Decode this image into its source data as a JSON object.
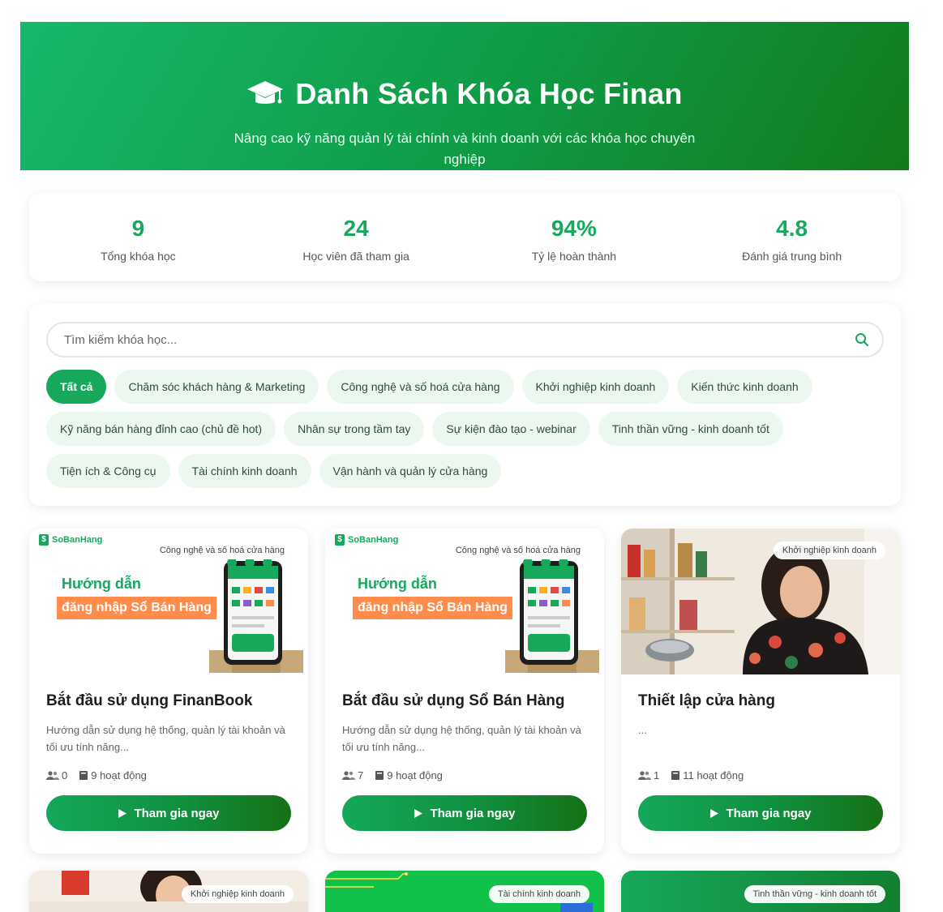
{
  "header": {
    "icon": "graduation-cap-icon",
    "title": "Danh Sách Khóa Học Finan",
    "subtitle": "Nâng cao kỹ năng quản lý tài chính và kinh doanh với các khóa học chuyên nghiệp"
  },
  "stats": [
    {
      "value": "9",
      "label": "Tổng khóa học"
    },
    {
      "value": "24",
      "label": "Học viên đã tham gia"
    },
    {
      "value": "94%",
      "label": "Tỷ lệ hoàn thành"
    },
    {
      "value": "4.8",
      "label": "Đánh giá trung bình"
    }
  ],
  "search": {
    "placeholder": "Tìm kiếm khóa học..."
  },
  "filters": {
    "active": "Tất cả",
    "row1": [
      "Tất cả",
      "Chăm sóc khách hàng & Marketing",
      "Công nghệ và số hoá cửa hàng",
      "Khởi nghiệp kinh doanh",
      "Kiến thức kinh doanh"
    ],
    "row2": [
      "Kỹ năng bán hàng đỉnh cao (chủ đề hot)",
      "Nhân sự trong tầm tay",
      "Sự kiện đào tạo - webinar",
      "Tinh thần vững - kinh doanh tốt"
    ],
    "row3": [
      "Tiện ích & Công cụ",
      "Tài chính kinh doanh",
      "Vận hành và quản lý cửa hàng"
    ]
  },
  "thumb_texts": {
    "brand": "SoBanHang",
    "headline": "Hướng dẫn",
    "strip": "đăng nhập Sổ Bán Hàng"
  },
  "courses": [
    {
      "category": "Công nghệ và số hoá cửa hàng",
      "title": "Bắt đầu sử dụng FinanBook",
      "description": "Hướng dẫn sử dụng hệ thống, quản lý tài khoản và tối ưu tính năng...",
      "learners": "0",
      "activities": "9 hoạt động",
      "button": "Tham gia ngay"
    },
    {
      "category": "Công nghệ và số hoá cửa hàng",
      "title": "Bắt đầu sử dụng Sổ Bán Hàng",
      "description": "Hướng dẫn sử dụng hệ thống, quản lý tài khoản và tối ưu tính năng...",
      "learners": "7",
      "activities": "9 hoạt động",
      "button": "Tham gia ngay"
    },
    {
      "category": "Khởi nghiệp kinh doanh",
      "title": "Thiết lập cửa hàng",
      "description": "...",
      "learners": "1",
      "activities": "11 hoạt động",
      "button": "Tham gia ngay"
    }
  ],
  "next_row": [
    {
      "category": "Khởi nghiệp kinh doanh"
    },
    {
      "category": "Tài chính kinh doanh"
    },
    {
      "category": "Tinh thần vững - kinh doanh tốt"
    }
  ],
  "colors": {
    "primary": "#17a85c",
    "dark": "#137a1c",
    "chip_bg": "#ecf8ef",
    "strip": "#ff8c4a"
  }
}
